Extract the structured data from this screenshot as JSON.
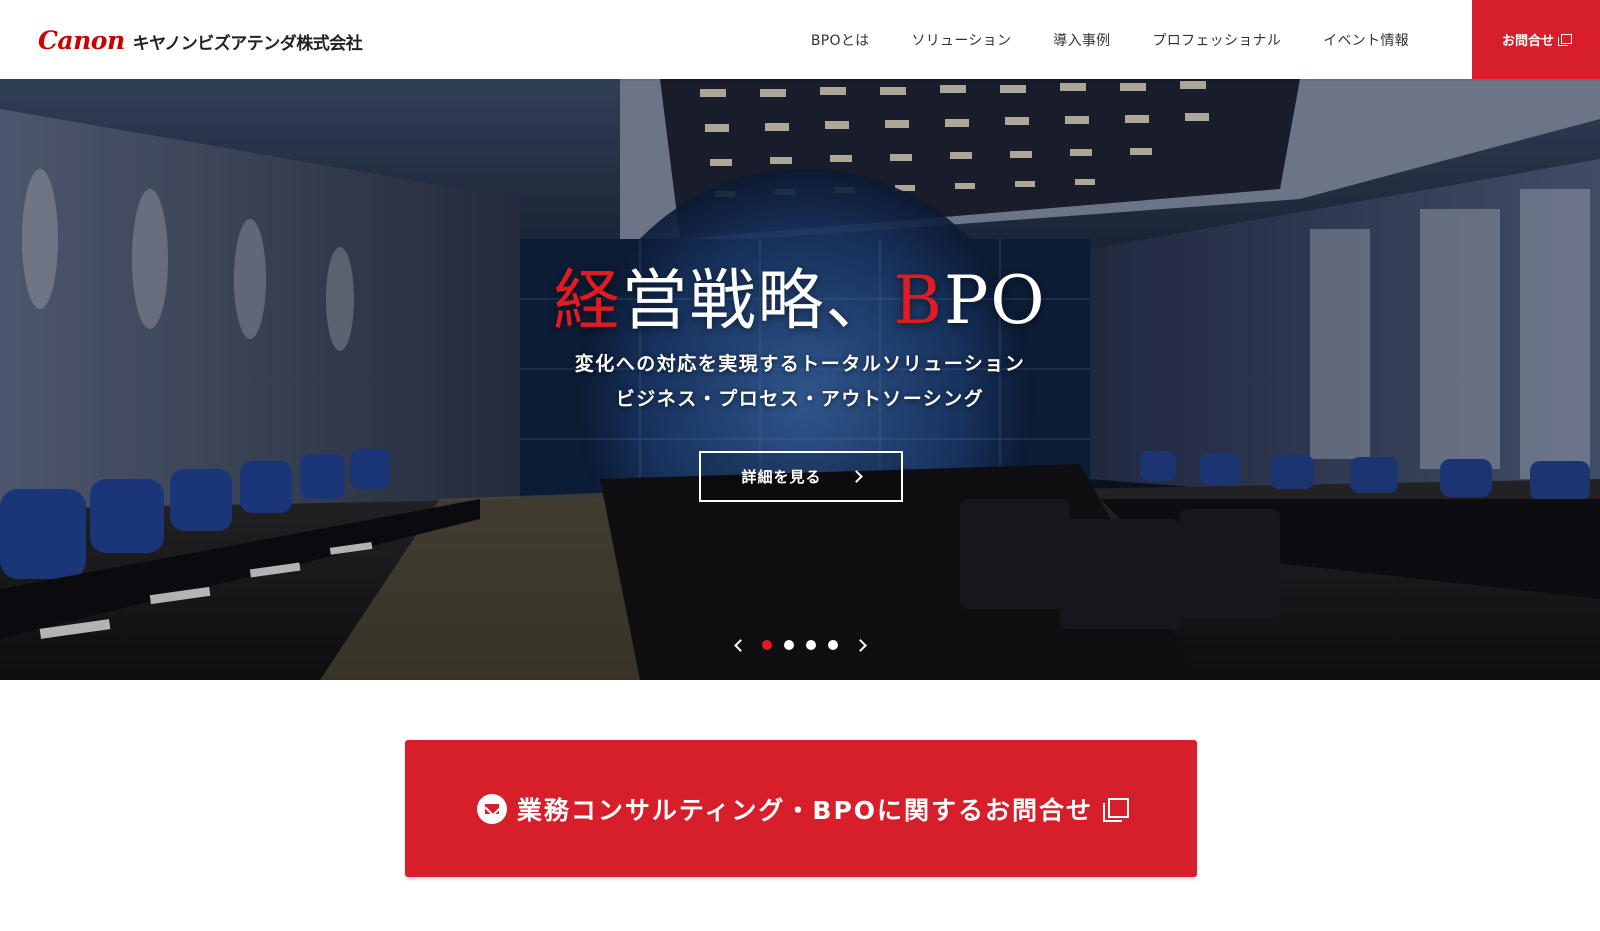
{
  "header": {
    "logo_brand": "Canon",
    "logo_company": "キヤノンビズアテンダ株式会社",
    "nav": [
      {
        "label": "BPOとは"
      },
      {
        "label": "ソリューション"
      },
      {
        "label": "導入事例"
      },
      {
        "label": "プロフェッショナル"
      },
      {
        "label": "イベント情報"
      }
    ],
    "contact_label": "お問合せ"
  },
  "hero": {
    "title_accent": "経",
    "title_main1": "営戦略、",
    "title_accent2": "B",
    "title_main2": "PO",
    "subtitle_line1": "変化への対応を実現するトータルソリューション",
    "subtitle_line2": "ビジネス・プロセス・アウトソーシング",
    "detail_button": "詳細を見る",
    "slides_total": 4,
    "active_slide": 1
  },
  "cta": {
    "label": "業務コンサルティング・BPOに関するお問合せ"
  },
  "colors": {
    "brand_red": "#d61f2b",
    "logo_red": "#cc0000"
  }
}
